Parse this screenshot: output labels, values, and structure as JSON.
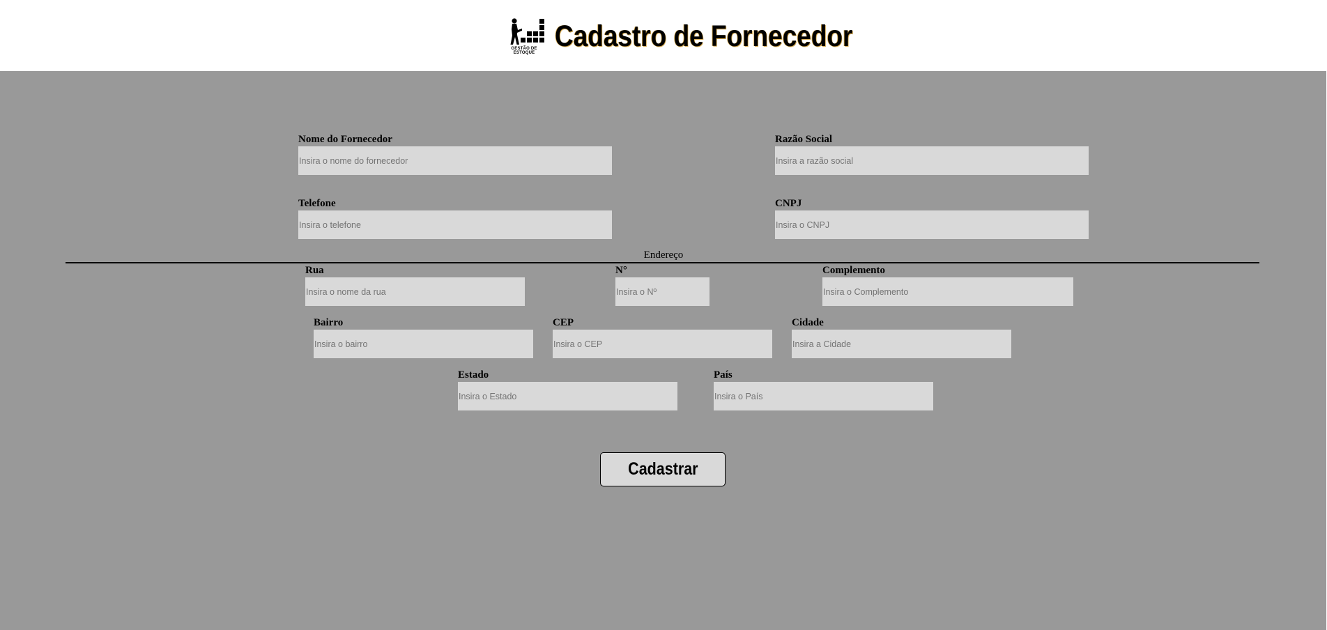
{
  "header": {
    "logo_caption": "GESTÃO DE ESTOQUE",
    "title": "Cadastro de Fornecedor"
  },
  "form": {
    "nome_fornecedor": {
      "label": "Nome do Fornecedor",
      "placeholder": "Insira o nome do fornecedor",
      "value": ""
    },
    "razao_social": {
      "label": "Razão Social",
      "placeholder": "Insira a razão social",
      "value": ""
    },
    "telefone": {
      "label": "Telefone",
      "placeholder": "Insira o telefone",
      "value": ""
    },
    "cnpj": {
      "label": "CNPJ",
      "placeholder": "Insira o CNPJ",
      "value": ""
    },
    "endereco_title": "Endereço",
    "rua": {
      "label": "Rua",
      "placeholder": "Insira o nome da rua",
      "value": ""
    },
    "numero": {
      "label": "N°",
      "placeholder": "Insira o Nº",
      "value": ""
    },
    "complemento": {
      "label": "Complemento",
      "placeholder": "Insira o Complemento",
      "value": ""
    },
    "bairro": {
      "label": "Bairro",
      "placeholder": "Insira o bairro",
      "value": ""
    },
    "cep": {
      "label": "CEP",
      "placeholder": "Insira o CEP",
      "value": ""
    },
    "cidade": {
      "label": "Cidade",
      "placeholder": "Insira a Cidade",
      "value": ""
    },
    "estado": {
      "label": "Estado",
      "placeholder": "Insira o Estado",
      "value": ""
    },
    "pais": {
      "label": "País",
      "placeholder": "Insira o País",
      "value": ""
    },
    "submit_label": "Cadastrar"
  },
  "colors": {
    "page_background": "#999999",
    "header_background": "#ffffff",
    "input_background": "#d9d9d9",
    "title_outline": "#d2a64b"
  },
  "icons": {
    "logo": "warehouse-worker-stacking-boxes-icon"
  }
}
